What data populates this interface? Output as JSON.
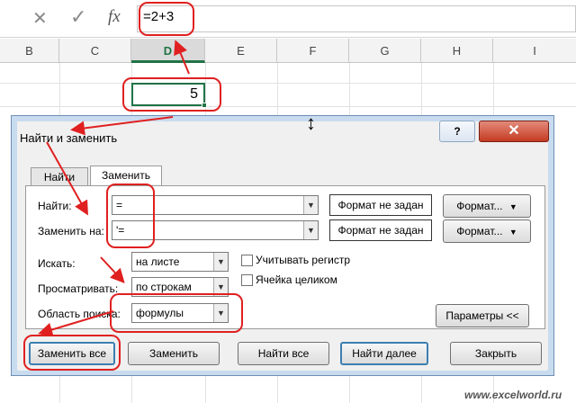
{
  "formula_bar": {
    "cancel_icon": "x-icon",
    "confirm_icon": "check-icon",
    "fx_label": "fx",
    "formula": "=2+3"
  },
  "columns": [
    "B",
    "C",
    "D",
    "E",
    "F",
    "G",
    "H",
    "I"
  ],
  "active_column": "D",
  "cell_value": "5",
  "dialog": {
    "title": "Найти и заменить",
    "help_label": "?",
    "close_label": "✕",
    "tabs": [
      {
        "label": "Найти",
        "active": false
      },
      {
        "label": "Заменить",
        "active": true
      }
    ],
    "find_label": "Найти:",
    "find_value": "=",
    "replace_label": "Заменить на:",
    "replace_value": "'=",
    "format_not_set_1": "Формат не задан",
    "format_not_set_2": "Формат не задан",
    "format_btn_1": "Формат...",
    "format_btn_2": "Формат...",
    "within_label": "Искать:",
    "within_value": "на листе",
    "search_label": "Просматривать:",
    "search_value": "по строкам",
    "lookin_label": "Область поиска:",
    "lookin_value": "формулы",
    "match_case_label": "Учитывать регистр",
    "match_cell_label": "Ячейка целиком",
    "options_btn": "Параметры <<",
    "replace_all_btn": "Заменить все",
    "replace_btn": "Заменить",
    "find_all_btn": "Найти все",
    "find_next_btn": "Найти далее",
    "close_btn": "Закрыть"
  },
  "watermark": "www.excelworld.ru",
  "colors": {
    "accent_green": "#217346",
    "annotation_red": "#e02020"
  }
}
